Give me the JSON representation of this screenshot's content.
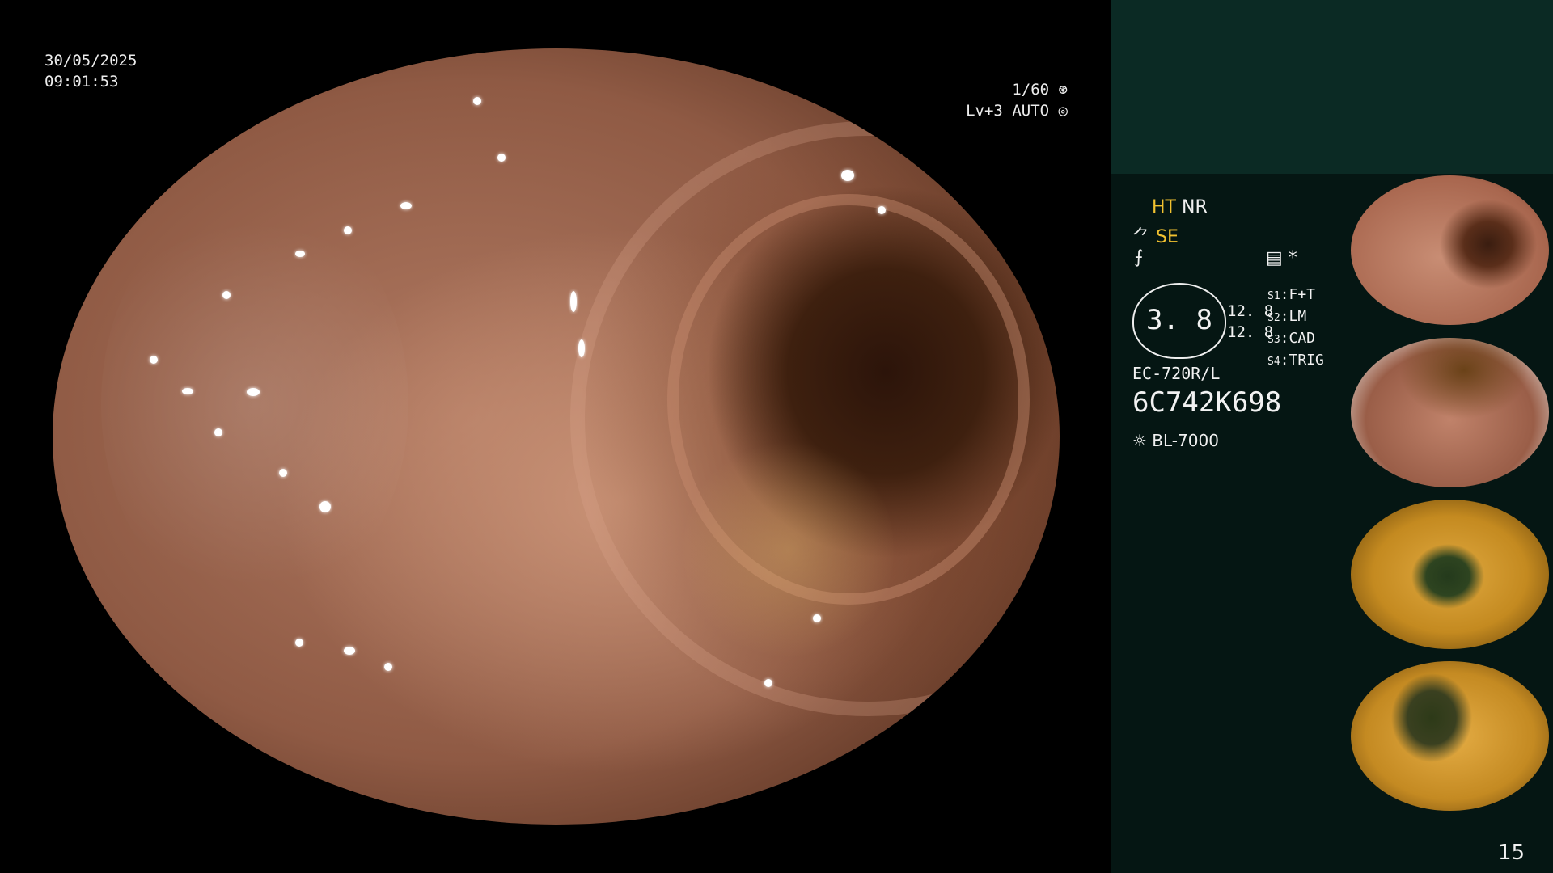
{
  "osd": {
    "date": "30/05/2025",
    "time": "09:01:53",
    "shutter": "1/60",
    "level": "Lv+3",
    "iris": "AUTO"
  },
  "panel": {
    "ht": "HT",
    "nr": "NR",
    "se": "SE",
    "asterisk": "*",
    "gauge_value": "3. 8",
    "val_top": "12. 8",
    "val_bottom": "12. 8",
    "switches": [
      {
        "key": "S1",
        "value": "F+T"
      },
      {
        "key": "S2",
        "value": "LM"
      },
      {
        "key": "S3",
        "value": "CAD"
      },
      {
        "key": "S4",
        "value": "TRIG"
      }
    ],
    "scope_model": "EC-720R/L",
    "serial": "6C742K698",
    "light_source": "BL-7000",
    "frame_number": "15"
  },
  "thumbnails": [
    {
      "index": "1"
    },
    {
      "index": "2"
    },
    {
      "index": "3"
    },
    {
      "index": "4"
    }
  ],
  "colors": {
    "panel_bg": "#051613",
    "panel_top": "#0b2a24",
    "highlight": "#f2c230"
  },
  "icons": [
    "shutter-icon",
    "iris-icon",
    "structure-enhance-icon",
    "freeze-icon",
    "menu-icon",
    "light-icon"
  ]
}
